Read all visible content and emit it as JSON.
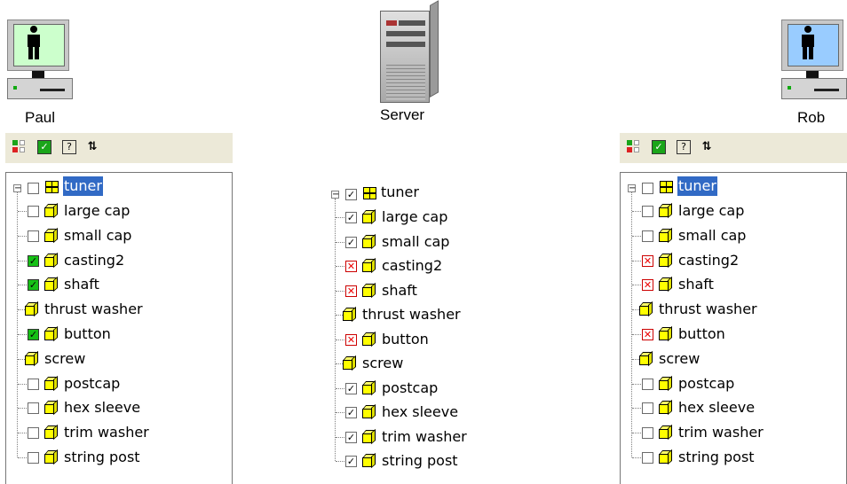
{
  "users": {
    "left": {
      "name": "Paul",
      "screen_color": "#ccffcc"
    },
    "right": {
      "name": "Rob",
      "screen_color": "#99ccff"
    }
  },
  "server": {
    "name": "Server"
  },
  "toolbar": {
    "icons": [
      "color-grid-icon",
      "checkbox-icon",
      "help-icon",
      "refresh-icon"
    ],
    "refresh_glyph": "⇅",
    "help_glyph": "?"
  },
  "trees": {
    "paul": {
      "root": {
        "label": "tuner",
        "selected": true,
        "checkbox": "empty"
      },
      "items": [
        {
          "label": "large cap",
          "checkbox": "empty"
        },
        {
          "label": "small cap",
          "checkbox": "empty"
        },
        {
          "label": "casting2",
          "checkbox": "green"
        },
        {
          "label": "shaft",
          "checkbox": "green"
        },
        {
          "label": "thrust washer",
          "checkbox": "none"
        },
        {
          "label": "button",
          "checkbox": "green"
        },
        {
          "label": "screw",
          "checkbox": "none"
        },
        {
          "label": "postcap",
          "checkbox": "empty"
        },
        {
          "label": "hex sleeve",
          "checkbox": "empty"
        },
        {
          "label": "trim washer",
          "checkbox": "empty"
        },
        {
          "label": "string post",
          "checkbox": "empty"
        }
      ]
    },
    "server": {
      "root": {
        "label": "tuner",
        "selected": false,
        "checkbox": "check"
      },
      "items": [
        {
          "label": "large cap",
          "checkbox": "check"
        },
        {
          "label": "small cap",
          "checkbox": "check"
        },
        {
          "label": "casting2",
          "checkbox": "red"
        },
        {
          "label": "shaft",
          "checkbox": "red"
        },
        {
          "label": "thrust washer",
          "checkbox": "none"
        },
        {
          "label": "button",
          "checkbox": "red"
        },
        {
          "label": "screw",
          "checkbox": "none"
        },
        {
          "label": "postcap",
          "checkbox": "check"
        },
        {
          "label": "hex sleeve",
          "checkbox": "check"
        },
        {
          "label": "trim washer",
          "checkbox": "check"
        },
        {
          "label": "string post",
          "checkbox": "check"
        }
      ]
    },
    "rob": {
      "root": {
        "label": "tuner",
        "selected": true,
        "checkbox": "empty"
      },
      "items": [
        {
          "label": "large cap",
          "checkbox": "empty"
        },
        {
          "label": "small cap",
          "checkbox": "empty"
        },
        {
          "label": "casting2",
          "checkbox": "red"
        },
        {
          "label": "shaft",
          "checkbox": "red"
        },
        {
          "label": "thrust washer",
          "checkbox": "none"
        },
        {
          "label": "button",
          "checkbox": "red"
        },
        {
          "label": "screw",
          "checkbox": "none"
        },
        {
          "label": "postcap",
          "checkbox": "empty"
        },
        {
          "label": "hex sleeve",
          "checkbox": "empty"
        },
        {
          "label": "trim washer",
          "checkbox": "empty"
        },
        {
          "label": "string post",
          "checkbox": "empty"
        }
      ]
    }
  }
}
